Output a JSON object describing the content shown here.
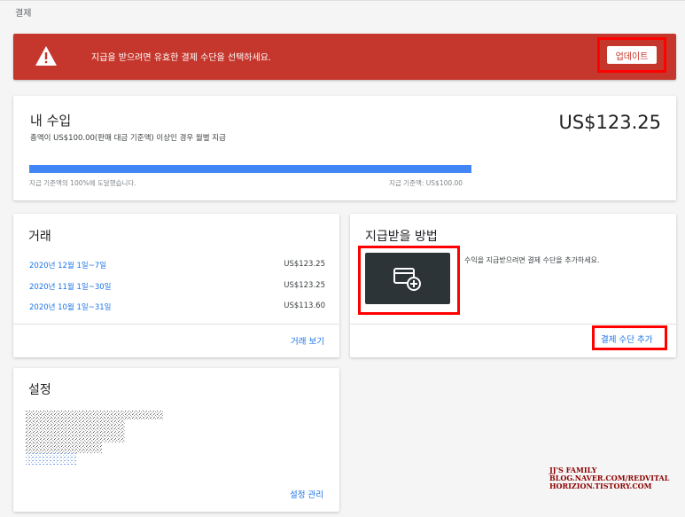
{
  "breadcrumb": "결제",
  "alert": {
    "message": "지급을 받으려면 유효한 결제 수단을 선택하세요.",
    "update_label": "업데이트"
  },
  "earnings": {
    "title": "내 수입",
    "subtitle": "총액이 US$100.00(판매 대금 기준액) 이상인 경우 월별 지급",
    "amount": "US$123.25",
    "progress_percent": 100,
    "reached_text": "지급 기준액의 100%에 도달했습니다.",
    "threshold_text": "지급 기준액: US$100.00"
  },
  "transactions": {
    "title": "거래",
    "rows": [
      {
        "period": "2020년 12월 1일~7일",
        "amount": "US$123.25"
      },
      {
        "period": "2020년 11월 1일~30일",
        "amount": "US$123.25"
      },
      {
        "period": "2020년 10월 1일~31일",
        "amount": "US$113.60"
      }
    ],
    "view_label": "거래 보기"
  },
  "payment": {
    "title": "지급받을 방법",
    "description": "수익을 지급받으려면 결제 수단을 추가하세요.",
    "add_label": "결제 수단 추가",
    "tile_icon": "add-card-icon"
  },
  "settings": {
    "title": "설정",
    "manage_label": "설정 관리"
  },
  "watermark": {
    "line1": "JJ'S FAMILY",
    "line2": "BLOG.NAVER.COM/REDVITAL",
    "line3": "HORIZION.TISTORY.COM"
  },
  "colors": {
    "alert_bg": "#c5372c",
    "progress": "#4285f4",
    "link": "#1a73e8",
    "highlight": "#ff0000"
  }
}
